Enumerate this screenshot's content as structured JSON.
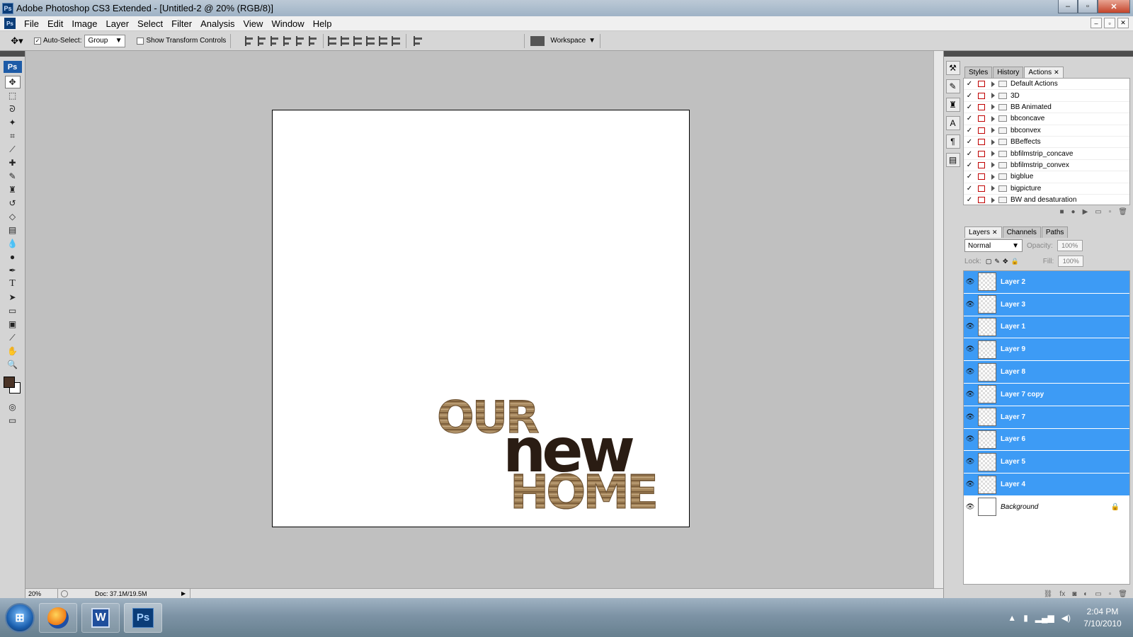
{
  "window": {
    "title": "Adobe Photoshop CS3 Extended - [Untitled-2 @ 20% (RGB/8)]",
    "app_badge": "Ps",
    "minimize": "–",
    "maximize": "▫",
    "close": "✕"
  },
  "menu": {
    "items": [
      "File",
      "Edit",
      "Image",
      "Layer",
      "Select",
      "Filter",
      "Analysis",
      "View",
      "Window",
      "Help"
    ]
  },
  "options": {
    "auto_select_label": "Auto-Select:",
    "auto_select_value": "Group",
    "show_transform_label": "Show Transform Controls",
    "workspace_label": "Workspace"
  },
  "toolbox": {
    "badge": "Ps",
    "foreground_color": "#4a3326"
  },
  "document": {
    "title_words": [
      "OUR",
      "new",
      "HOME"
    ],
    "wood_color": "#9c7b52",
    "dark_color": "#2a1c13"
  },
  "status": {
    "zoom": "20%",
    "doc_info": "Doc: 37.1M/19.5M"
  },
  "actions_panel": {
    "tabs": [
      "Styles",
      "History",
      "Actions"
    ],
    "active_tab": "Actions",
    "items": [
      "Default Actions",
      "3D",
      "BB Animated",
      "bbconcave",
      "bbconvex",
      "BBeffects",
      "bbfilmstrip_concave",
      "bbfilmstrip_convex",
      "bigblue",
      "bigpicture",
      "BW and desaturation"
    ]
  },
  "layers_panel": {
    "tabs": [
      "Layers",
      "Channels",
      "Paths"
    ],
    "blend_mode": "Normal",
    "opacity_label": "Opacity:",
    "opacity_value": "100%",
    "lock_label": "Lock:",
    "fill_label": "Fill:",
    "fill_value": "100%",
    "selection_color": "#3d9bf5",
    "layers": [
      {
        "name": "Layer 2",
        "selected": true
      },
      {
        "name": "Layer 3",
        "selected": true
      },
      {
        "name": "Layer 1",
        "selected": true
      },
      {
        "name": "Layer 9",
        "selected": true
      },
      {
        "name": "Layer 8",
        "selected": true
      },
      {
        "name": "Layer 7 copy",
        "selected": true
      },
      {
        "name": "Layer 7",
        "selected": true
      },
      {
        "name": "Layer 6",
        "selected": true
      },
      {
        "name": "Layer 5",
        "selected": true
      },
      {
        "name": "Layer 4",
        "selected": true
      },
      {
        "name": "Background",
        "selected": false
      }
    ]
  },
  "taskbar": {
    "time": "2:04 PM",
    "date": "7/10/2010",
    "word_letter": "W",
    "ps_letters": "Ps"
  }
}
